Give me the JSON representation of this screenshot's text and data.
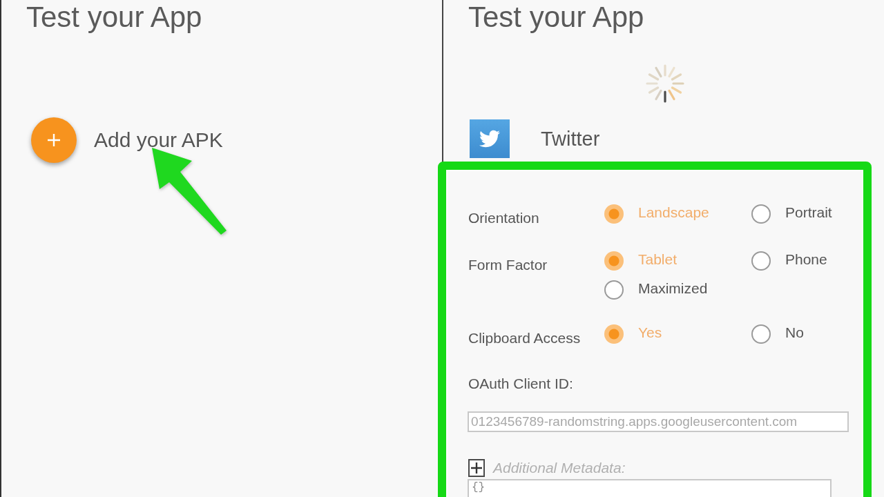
{
  "left_panel": {
    "title": "Test your App",
    "add_label": "Add your APK"
  },
  "right_panel": {
    "title": "Test your App",
    "loading": true,
    "app": {
      "name": "Twitter"
    },
    "settings": [
      {
        "label": "Orientation",
        "choices": [
          {
            "label": "Landscape",
            "selected": true
          },
          {
            "label": "Portrait",
            "selected": false
          }
        ]
      },
      {
        "label": "Form Factor",
        "choices": [
          {
            "label": "Tablet",
            "selected": true
          },
          {
            "label": "Phone",
            "selected": false
          },
          {
            "label": "Maximized",
            "selected": false
          }
        ]
      },
      {
        "label": "Clipboard Access",
        "choices": [
          {
            "label": "Yes",
            "selected": true
          },
          {
            "label": "No",
            "selected": false
          }
        ]
      }
    ],
    "oauth_client_id": {
      "label": "OAuth Client ID:",
      "placeholder": "0123456789-randomstring.apps.googleusercontent.com"
    },
    "metadata": {
      "label": "Additional Metadata:",
      "value": "{}"
    }
  }
}
